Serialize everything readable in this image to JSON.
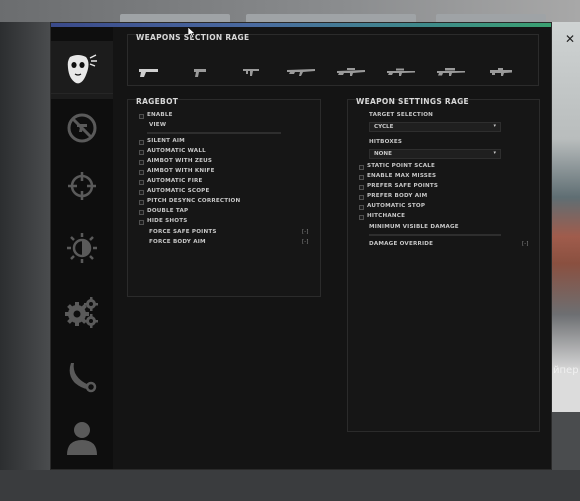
{
  "background": {
    "side_text": "йпер",
    "close_glyph": "✕"
  },
  "sidebar": {
    "items": [
      {
        "name": "ragebot",
        "icon": "mask-icon"
      },
      {
        "name": "antiaim",
        "icon": "no-shoot-icon"
      },
      {
        "name": "legitbot",
        "icon": "crosshair-icon"
      },
      {
        "name": "visuals",
        "icon": "contrast-icon"
      },
      {
        "name": "misc",
        "icon": "gears-icon"
      },
      {
        "name": "skins",
        "icon": "knife-icon"
      },
      {
        "name": "profile",
        "icon": "user-icon"
      }
    ]
  },
  "weapons_section": {
    "title": "WEAPONS SECTION RAGE",
    "weapons": [
      "deagle-icon",
      "pistol-icon",
      "smg-icon",
      "rifle-icon",
      "auto-sniper-icon",
      "scout-icon",
      "awp-icon",
      "heavy-icon"
    ]
  },
  "ragebot": {
    "title": "RAGEBOT",
    "enable_label": "ENABLE",
    "view_label": "VIEW",
    "options": [
      "SILENT AIM",
      "AUTOMATIC WALL",
      "AIMBOT WITH ZEUS",
      "AIMBOT WITH KNIFE",
      "AUTOMATIC FIRE",
      "AUTOMATIC SCOPE",
      "PITCH DESYNC CORRECTION",
      "DOUBLE TAP",
      "HIDE SHOTS"
    ],
    "keybinds": [
      {
        "label": "FORCE SAFE POINTS",
        "key": "[-]"
      },
      {
        "label": "FORCE BODY AIM",
        "key": "[-]"
      }
    ]
  },
  "weapon_settings": {
    "title": "WEAPON SETTINGS RAGE",
    "target_selection_label": "TARGET SELECTION",
    "target_selection_value": "CYCLE",
    "hitboxes_label": "HITBOXES",
    "hitboxes_value": "NONE",
    "options": [
      "STATIC POINT SCALE",
      "ENABLE MAX MISSES",
      "PREFER SAFE POINTS",
      "PREFER BODY AIM",
      "AUTOMATIC STOP",
      "HITCHANCE"
    ],
    "min_damage_label": "MINIMUM VISIBLE DAMAGE",
    "damage_override_label": "DAMAGE OVERRIDE",
    "damage_override_key": "[-]"
  },
  "colors": {
    "accent_blue": "#4a6aa0",
    "accent_green": "#3aa070"
  }
}
